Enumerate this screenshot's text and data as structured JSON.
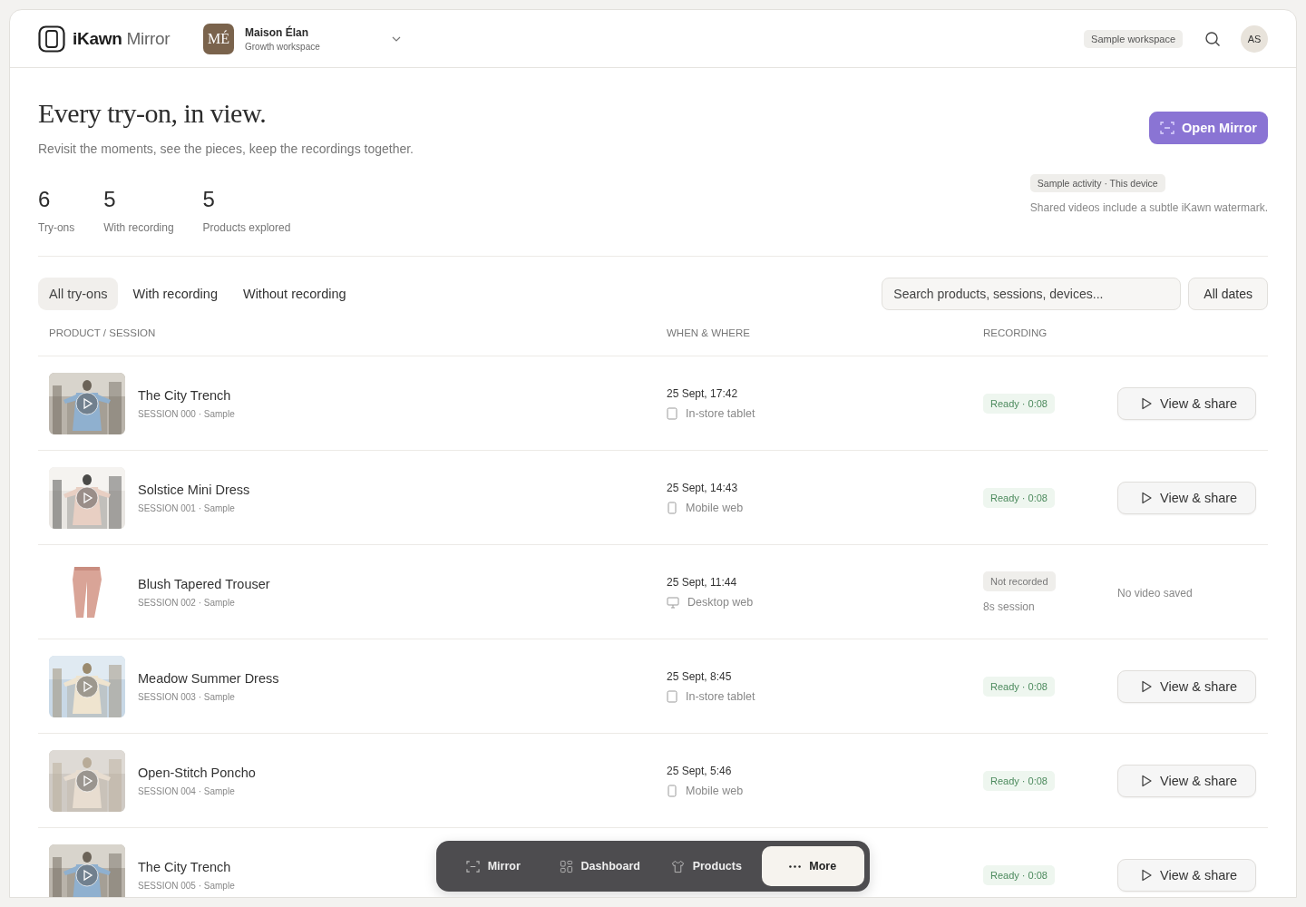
{
  "header": {
    "logo_bold": "iKawn",
    "logo_light": "Mirror",
    "workspace": {
      "initials": "MÉ",
      "name": "Maison Élan",
      "plan": "Growth workspace"
    },
    "badge": "Sample workspace",
    "avatar": "AS"
  },
  "hero": {
    "title": "Every try-on, in view.",
    "subtitle": "Revisit the moments, see the pieces, keep the recordings together.",
    "button": "Open Mirror"
  },
  "stats": [
    {
      "value": "6",
      "label": "Try-ons"
    },
    {
      "value": "5",
      "label": "With recording"
    },
    {
      "value": "5",
      "label": "Products explored"
    }
  ],
  "notice": {
    "badge": "Sample activity · This device",
    "note": "Shared videos include a subtle iKawn watermark."
  },
  "tabs": [
    {
      "label": "All try-ons",
      "selected": true
    },
    {
      "label": "With recording",
      "selected": false
    },
    {
      "label": "Without recording",
      "selected": false
    }
  ],
  "search": {
    "placeholder": "Search products, sessions, devices..."
  },
  "date_filter": "All dates",
  "columns": [
    "PRODUCT / SESSION",
    "WHEN & WHERE",
    "RECORDING"
  ],
  "rows": [
    {
      "product": "The City Trench",
      "session": "SESSION 000 · Sample",
      "when": "25 Sept, 17:42",
      "device": {
        "kind": "tablet",
        "label": "In-store tablet"
      },
      "recording": {
        "kind": "ready",
        "status": "Ready · 0:08"
      },
      "action": {
        "kind": "button",
        "label": "View & share"
      }
    },
    {
      "product": "Solstice Mini Dress",
      "session": "SESSION 001 · Sample",
      "when": "25 Sept, 14:43",
      "device": {
        "kind": "phone",
        "label": "Mobile web"
      },
      "recording": {
        "kind": "ready",
        "status": "Ready · 0:08"
      },
      "action": {
        "kind": "button",
        "label": "View & share"
      }
    },
    {
      "product": "Blush Tapered Trouser",
      "session": "SESSION 002 · Sample",
      "when": "25 Sept, 11:44",
      "device": {
        "kind": "desktop",
        "label": "Desktop web"
      },
      "recording": {
        "kind": "none",
        "status": "Not recorded",
        "detail": "8s session"
      },
      "action": {
        "kind": "text",
        "label": "No video saved"
      }
    },
    {
      "product": "Meadow Summer Dress",
      "session": "SESSION 003 · Sample",
      "when": "25 Sept, 8:45",
      "device": {
        "kind": "tablet",
        "label": "In-store tablet"
      },
      "recording": {
        "kind": "ready",
        "status": "Ready · 0:08"
      },
      "action": {
        "kind": "button",
        "label": "View & share"
      }
    },
    {
      "product": "Open-Stitch Poncho",
      "session": "SESSION 004 · Sample",
      "when": "25 Sept, 5:46",
      "device": {
        "kind": "phone",
        "label": "Mobile web"
      },
      "recording": {
        "kind": "ready",
        "status": "Ready · 0:08"
      },
      "action": {
        "kind": "button",
        "label": "View & share"
      }
    },
    {
      "product": "The City Trench",
      "session": "SESSION 005 · Sample",
      "recording": {
        "kind": "ready",
        "status": "Ready · 0:08"
      },
      "action": {
        "kind": "button",
        "label": "View & share"
      }
    }
  ],
  "nav": [
    {
      "kind": "mirror",
      "label": "Mirror",
      "selected": false
    },
    {
      "kind": "dashboard",
      "label": "Dashboard",
      "selected": false
    },
    {
      "kind": "products",
      "label": "Products",
      "selected": false
    },
    {
      "kind": "more",
      "label": "More",
      "selected": true
    }
  ]
}
